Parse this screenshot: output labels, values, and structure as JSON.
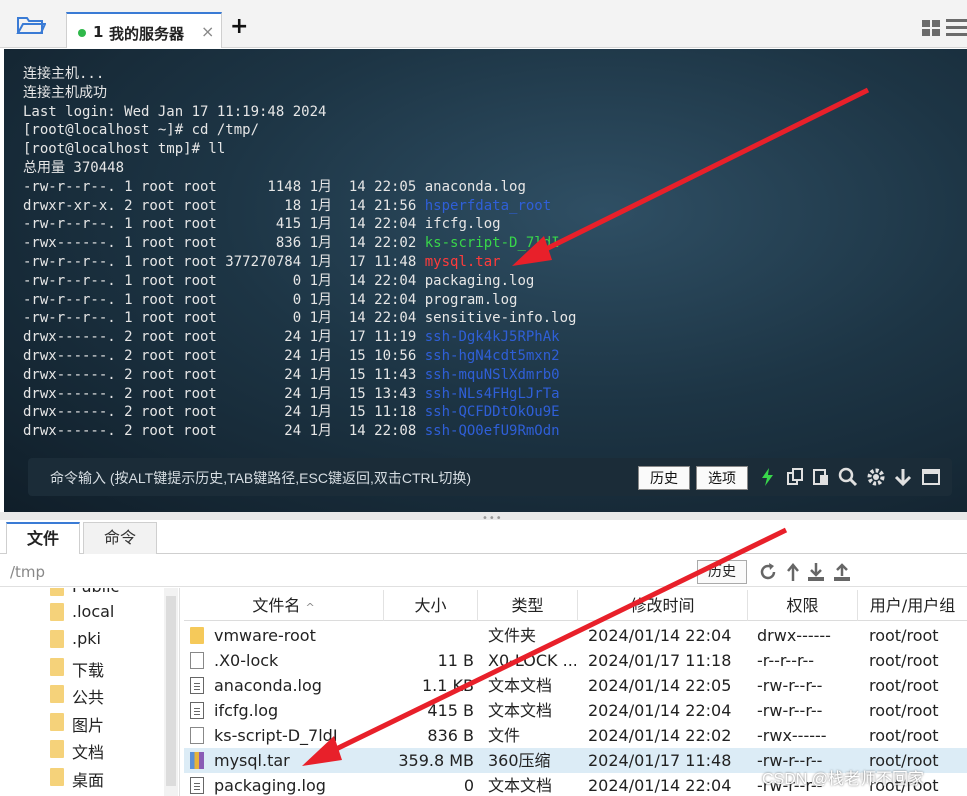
{
  "tabbar": {
    "tab_number": "1",
    "tab_title": "我的服务器",
    "close_glyph": "×",
    "add_glyph": "+",
    "icons": [
      "folder-open-icon",
      "grid-layout-icon",
      "menu-icon"
    ]
  },
  "terminal": {
    "intro": [
      "连接主机...",
      "连接主机成功",
      "Last login: Wed Jan 17 11:19:48 2024",
      "[root@localhost ~]# cd /tmp/",
      "[root@localhost tmp]# ll",
      "总用量 370448"
    ],
    "listing": [
      {
        "prefix": "-rw-r--r--. 1 root root      1148 1月  14 22:05 ",
        "name": "anaconda.log",
        "kind": "file"
      },
      {
        "prefix": "drwxr-xr-x. 2 root root        18 1月  14 21:56 ",
        "name": "hsperfdata_root",
        "kind": "dir"
      },
      {
        "prefix": "-rw-r--r--. 1 root root       415 1月  14 22:04 ",
        "name": "ifcfg.log",
        "kind": "file"
      },
      {
        "prefix": "-rwx------. 1 root root       836 1月  14 22:02 ",
        "name": "ks-script-D_7ldI",
        "kind": "exe"
      },
      {
        "prefix": "-rw-r--r--. 1 root root 377270784 1月  17 11:48 ",
        "name": "mysql.tar",
        "kind": "arc"
      },
      {
        "prefix": "-rw-r--r--. 1 root root         0 1月  14 22:04 ",
        "name": "packaging.log",
        "kind": "file"
      },
      {
        "prefix": "-rw-r--r--. 1 root root         0 1月  14 22:04 ",
        "name": "program.log",
        "kind": "file"
      },
      {
        "prefix": "-rw-r--r--. 1 root root         0 1月  14 22:04 ",
        "name": "sensitive-info.log",
        "kind": "file"
      },
      {
        "prefix": "drwx------. 2 root root        24 1月  17 11:19 ",
        "name": "ssh-Dgk4kJ5RPhAk",
        "kind": "dir"
      },
      {
        "prefix": "drwx------. 2 root root        24 1月  15 10:56 ",
        "name": "ssh-hgN4cdt5mxn2",
        "kind": "dir"
      },
      {
        "prefix": "drwx------. 2 root root        24 1月  15 11:43 ",
        "name": "ssh-mquNSlXdmrb0",
        "kind": "dir"
      },
      {
        "prefix": "drwx------. 2 root root        24 1月  15 13:43 ",
        "name": "ssh-NLs4FHgLJrTa",
        "kind": "dir"
      },
      {
        "prefix": "drwx------. 2 root root        24 1月  15 11:18 ",
        "name": "ssh-QCFDDtOkOu9E",
        "kind": "dir"
      },
      {
        "prefix": "drwx------. 2 root root        24 1月  14 22:08 ",
        "name": "ssh-QO0efU9RmOdn",
        "kind": "dir"
      }
    ],
    "colors": {
      "file": "#e6e6e6",
      "dir": "#2f5fd8",
      "exe": "#38d64a",
      "arc": "#ff3b3b"
    }
  },
  "cmdbar": {
    "placeholder": "命令输入 (按ALT键提示历史,TAB键路径,ESC键返回,双击CTRL切换)",
    "history_label": "历史",
    "options_label": "选项",
    "icons": [
      "lightning-icon",
      "copy-icon",
      "paste-icon",
      "search-icon",
      "gear-icon",
      "download-arrow-icon",
      "window-icon"
    ]
  },
  "bottom_tabs": {
    "files": "文件",
    "commands": "命令"
  },
  "pathbar": {
    "path": "/tmp",
    "history_label": "历史",
    "icons": [
      "refresh-icon",
      "up-arrow-icon",
      "download-icon",
      "upload-icon"
    ]
  },
  "tree": [
    "Public",
    ".local",
    ".pki",
    "下载",
    "公共",
    "图片",
    "文档",
    "桌面"
  ],
  "table": {
    "columns": [
      "文件名",
      "大小",
      "类型",
      "修改时间",
      "权限",
      "用户/用户组"
    ],
    "sort_glyph": "^",
    "rows": [
      {
        "icon": "folder",
        "name": "vmware-root",
        "size": "",
        "type": "文件夹",
        "mtime": "2024/01/14 22:04",
        "perm": "drwx------",
        "owner": "root/root"
      },
      {
        "icon": "blank",
        "name": ".X0-lock",
        "size": "11 B",
        "type": "X0-LOCK ...",
        "mtime": "2024/01/17 11:18",
        "perm": "-r--r--r--",
        "owner": "root/root"
      },
      {
        "icon": "doc",
        "name": "anaconda.log",
        "size": "1.1 KB",
        "type": "文本文档",
        "mtime": "2024/01/14 22:05",
        "perm": "-rw-r--r--",
        "owner": "root/root"
      },
      {
        "icon": "doc",
        "name": "ifcfg.log",
        "size": "415 B",
        "type": "文本文档",
        "mtime": "2024/01/14 22:04",
        "perm": "-rw-r--r--",
        "owner": "root/root"
      },
      {
        "icon": "blank",
        "name": "ks-script-D_7ldI",
        "size": "836 B",
        "type": "文件",
        "mtime": "2024/01/14 22:02",
        "perm": "-rwx------",
        "owner": "root/root"
      },
      {
        "icon": "arch",
        "name": "mysql.tar",
        "size": "359.8 MB",
        "type": "360压缩",
        "mtime": "2024/01/17 11:48",
        "perm": "-rw-r--r--",
        "owner": "root/root",
        "selected": true
      },
      {
        "icon": "doc",
        "name": "packaging.log",
        "size": "0",
        "type": "文本文档",
        "mtime": "2024/01/14 22:04",
        "perm": "-rw-r--r--",
        "owner": "root/root"
      }
    ]
  },
  "watermark": "CSDN @栈老师不回家",
  "annotation_color": "#e8202a"
}
